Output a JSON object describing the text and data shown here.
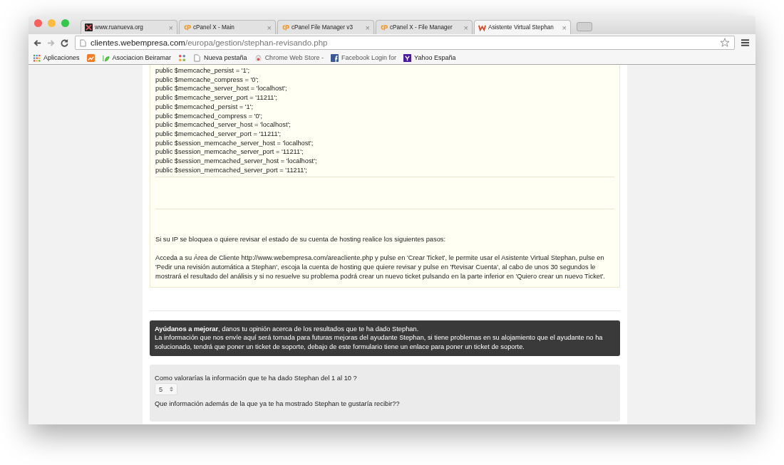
{
  "tabs": [
    {
      "label": "www.ruanueva.org",
      "kind": "site",
      "close": "×",
      "selected": false
    },
    {
      "label": "cPanel X - Main",
      "kind": "cpanel",
      "close": "×",
      "selected": false
    },
    {
      "label": "cPanel File Manager v3",
      "kind": "cpanel",
      "close": "×",
      "selected": false
    },
    {
      "label": "cPanel X - File Manager",
      "kind": "cpanel",
      "close": "×",
      "selected": false
    },
    {
      "label": "Asistente Virtual Stephan",
      "kind": "assistant",
      "close": "×",
      "selected": true
    }
  ],
  "address": {
    "host": "clientes.webempresa.com",
    "path": "/europa/gestion/stephan-revisando.php"
  },
  "bookmarks": [
    {
      "label": "Aplicaciones",
      "kind": "apps"
    },
    {
      "kind": "chart"
    },
    {
      "label": "Asociacion Beiramar",
      "kind": "leaf"
    },
    {
      "kind": "joomla"
    },
    {
      "label": "Nueva pestaña",
      "kind": "page"
    },
    {
      "label": "Chrome Web Store -",
      "kind": "store"
    },
    {
      "label": "Facebook Login for",
      "kind": "facebook"
    },
    {
      "label": "Yahoo España",
      "kind": "yahoo"
    }
  ],
  "code_lines": [
    "public $memcache_persist = '1';",
    "public $memcache_compress = '0';",
    "public $memcache_server_host = 'localhost';",
    "public $memcache_server_port = '11211';",
    "public $memcached_persist = '1';",
    "public $memcached_compress = '0';",
    "public $memcached_server_host = 'localhost';",
    "public $memcached_server_port = '11211';",
    "public $session_memcache_server_host = 'localhost';",
    "public $session_memcache_server_port = '11211';",
    "public $session_memcached_server_host = 'localhost';",
    "public $session_memcached_server_port = '11211';"
  ],
  "instructions": [
    "Si su IP se bloquea o quiere revisar el estado de su cuenta de hosting realice los siguientes pasos:",
    "Acceda a su Área de Cliente http://www.webempresa.com/areacliente.php y pulse en 'Crear Ticket', le permite usar el Asistente Virtual Stephan, pulse en 'Pedir una revisión automática a Stephan', escoja la cuenta de hosting que quiere revisar y pulse en 'Revisar Cuenta', al cabo de unos 30 segundos le mostrará el resultado del análisis y si no resuelve su problema podrá crear un nuevo ticket pulsando en la parte inferior en 'Quiero crear un nuevo Ticket'."
  ],
  "feedback_notice": [
    "**Ayúdanos a mejorar**, danos tu opinión acerca de los resultados que te ha dado Stephan.",
    "La información que nos envíe aquí será tomada para futuras mejoras del ayudante Stephan, si tiene problemas en su alojamiento que el ayudante no ha solucionado, tendrá que poner un ticket de soporte, debajo de este formulario tiene un enlace para poner un ticket de soporte."
  ],
  "form": {
    "rating_question": "Como valorarías la información que te ha dado Stephan del 1 al 10 ?",
    "rating_value": "5",
    "next_question": "Que información además de la que ya te ha mostrado Stephan te gustaría recibir??"
  }
}
